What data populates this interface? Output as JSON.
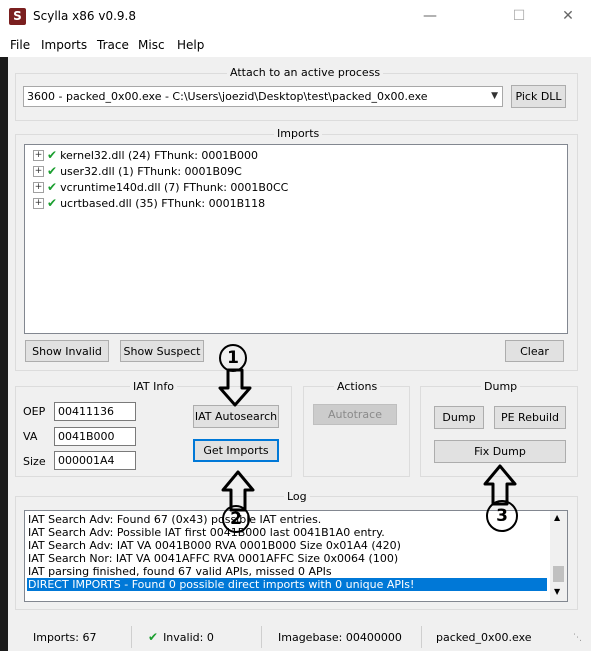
{
  "window": {
    "title": "Scylla x86 v0.9.8",
    "icon": "S"
  },
  "menu": [
    "File",
    "Imports",
    "Trace",
    "Misc",
    "Help"
  ],
  "attach": {
    "title": "Attach to an active process",
    "process": "3600 - packed_0x00.exe - C:\\Users\\joezid\\Desktop\\test\\packed_0x00.exe",
    "pick_dll": "Pick DLL"
  },
  "imports": {
    "title": "Imports",
    "items": [
      "kernel32.dll (24) FThunk: 0001B000",
      "user32.dll (1) FThunk: 0001B09C",
      "vcruntime140d.dll (7) FThunk: 0001B0CC",
      "ucrtbased.dll (35) FThunk: 0001B118"
    ],
    "show_invalid": "Show Invalid",
    "show_suspect": "Show Suspect",
    "clear": "Clear"
  },
  "iat": {
    "title": "IAT Info",
    "oep_label": "OEP",
    "oep": "00411136",
    "va_label": "VA",
    "va": "0041B000",
    "size_label": "Size",
    "size": "000001A4",
    "autosearch": "IAT Autosearch",
    "get_imports": "Get Imports"
  },
  "actions": {
    "title": "Actions",
    "autotrace": "Autotrace"
  },
  "dump": {
    "title": "Dump",
    "dump": "Dump",
    "pe_rebuild": "PE Rebuild",
    "fix_dump": "Fix Dump"
  },
  "log": {
    "title": "Log",
    "lines": [
      "IAT Search Adv: Found 67 (0x43) possible IAT entries.",
      "IAT Search Adv: Possible IAT first 0041B000 last 0041B1A0 entry.",
      "IAT Search Adv: IAT VA 0041B000 RVA 0001B000 Size 0x01A4 (420)",
      "IAT Search Nor: IAT VA 0041AFFC RVA 0001AFFC Size 0x0064 (100)",
      "IAT parsing finished, found 67 valid APIs, missed 0 APIs",
      "DIRECT IMPORTS - Found 0 possible direct imports with 0 unique APIs!"
    ]
  },
  "status": {
    "imports": "Imports: 67",
    "invalid": "Invalid: 0",
    "imagebase": "Imagebase: 00400000",
    "file": "packed_0x00.exe"
  },
  "annotations": [
    "1",
    "2",
    "3"
  ]
}
